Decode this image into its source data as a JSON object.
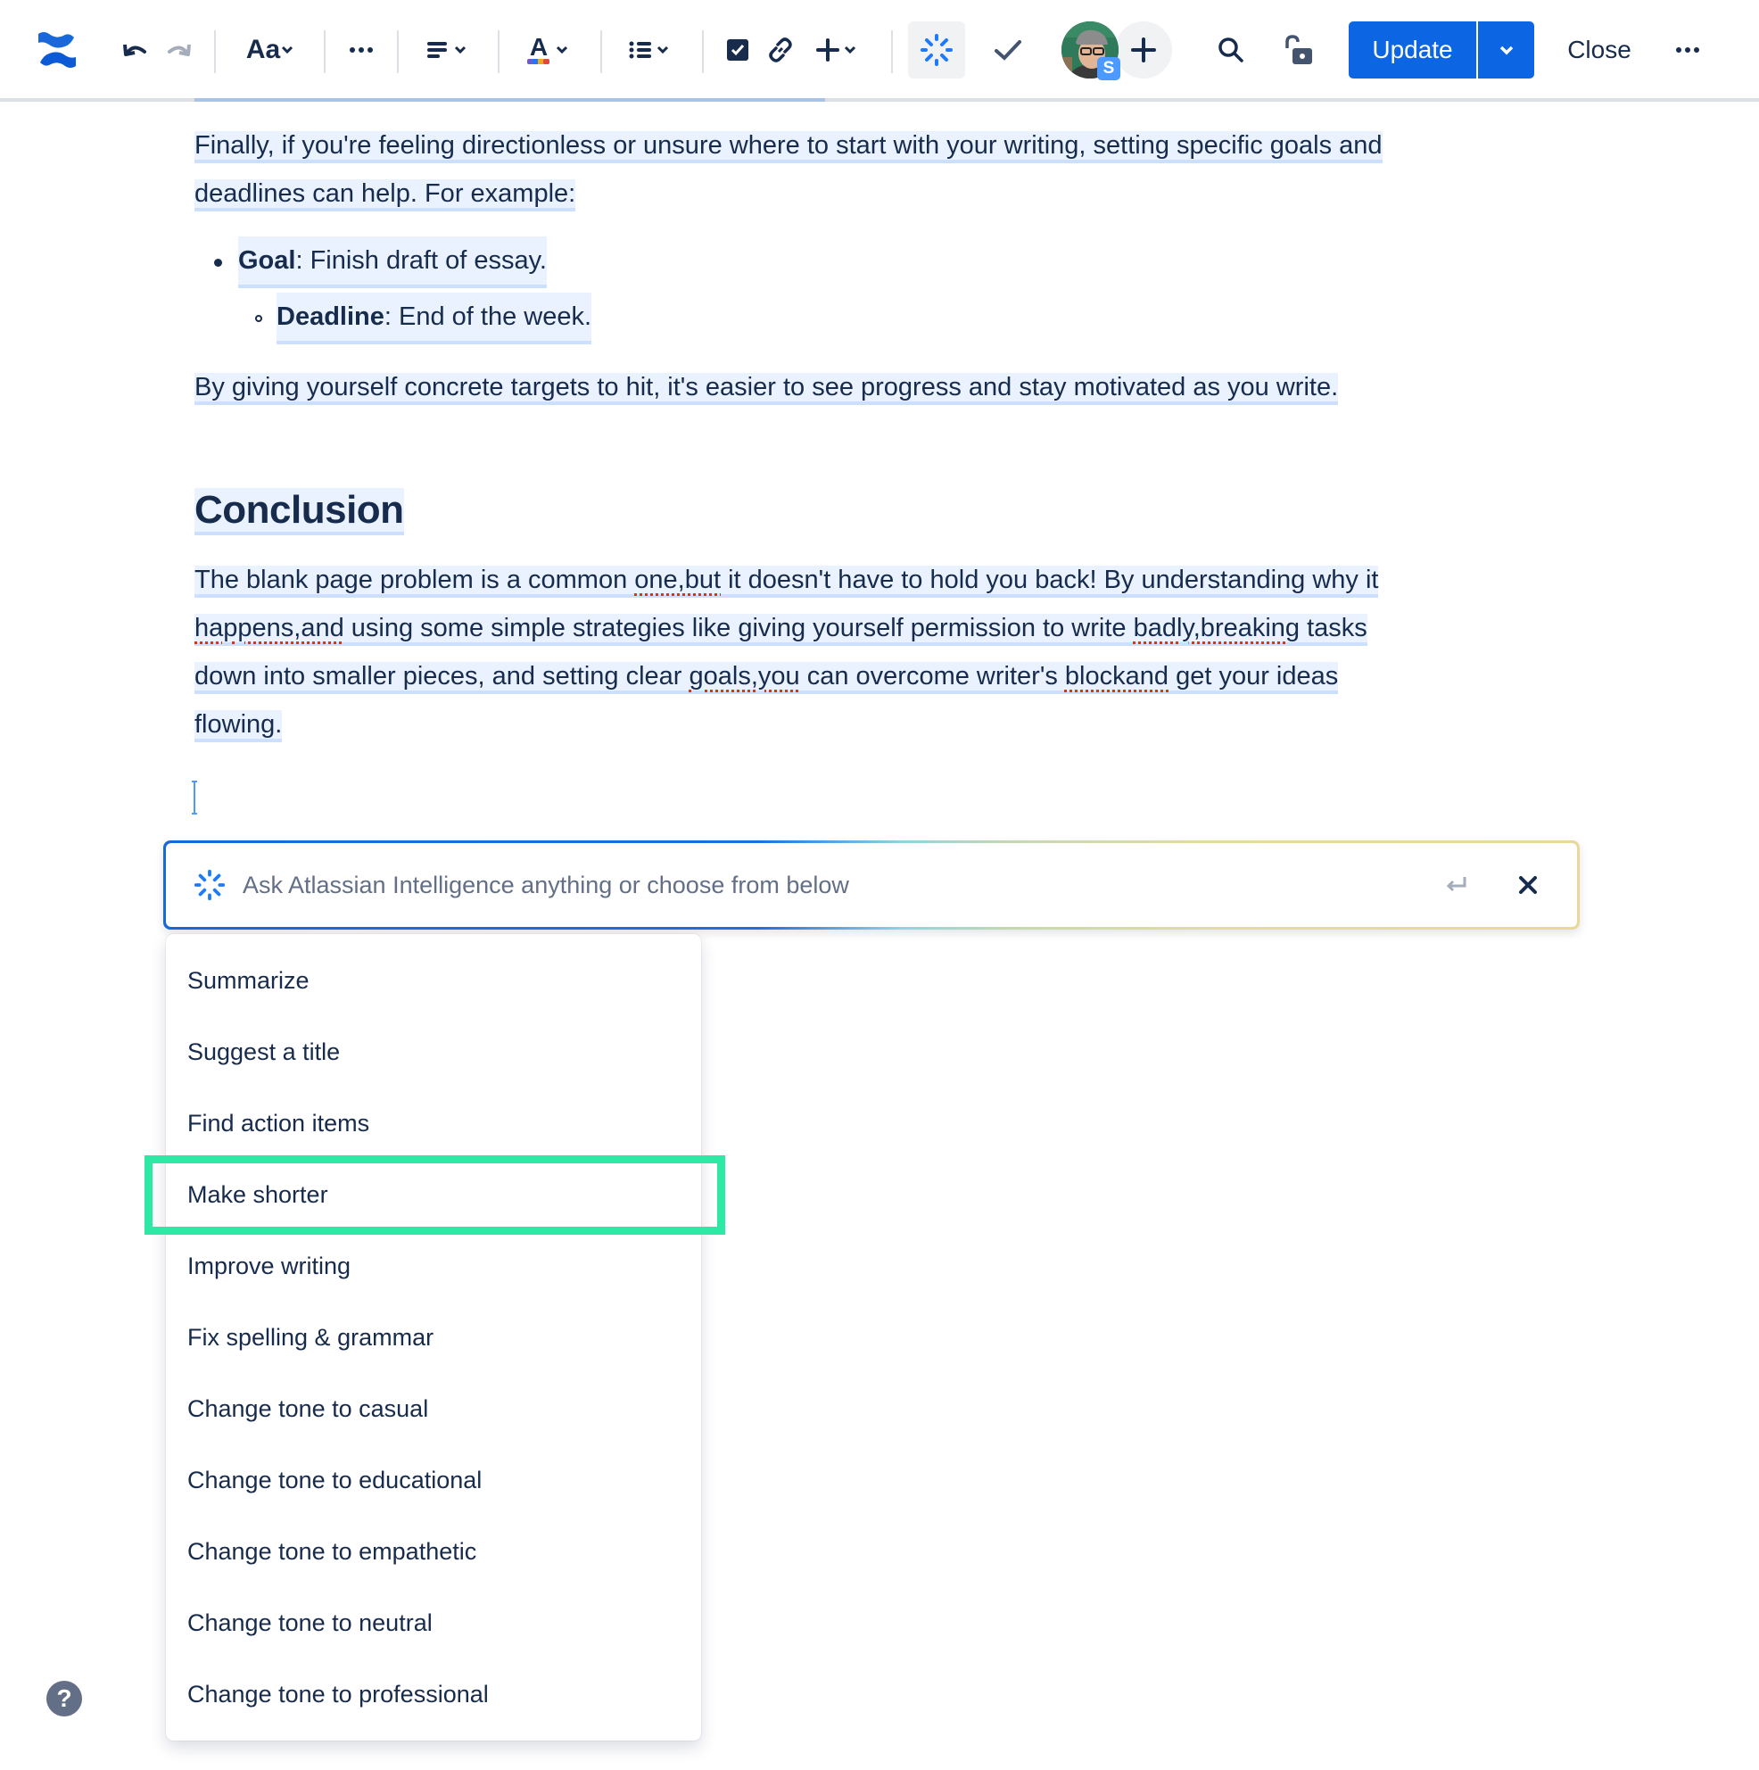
{
  "toolbar": {
    "undo": "undo-icon",
    "redo": "redo-icon",
    "text_style_label": "Aa",
    "more_formatting": "more-icon",
    "alignment": "align-icon",
    "text_color_label": "A",
    "text_color_swatches": [
      "#6e5dc6",
      "#1d7afc",
      "#f5a623",
      "#e2483d"
    ],
    "list": "bullet-list-icon",
    "action_item": "checkbox-icon",
    "link": "link-icon",
    "insert": "plus-icon",
    "ai": "atlassian-intelligence-icon",
    "check": "check-icon",
    "avatar_badge": "S",
    "add_collaborator": "plus-icon",
    "search": "search-icon",
    "restrictions": "unlock-icon",
    "update_label": "Update",
    "close_label": "Close",
    "more": "more-icon"
  },
  "document": {
    "para1_line1": "Finally, if you're feeling directionless or unsure where to start with your writing, setting specific goals and",
    "para1_line2": "deadlines can help. For example:",
    "bullet1_label": "Goal",
    "bullet1_text": ": Finish draft of essay.",
    "bullet2_label": "Deadline",
    "bullet2_text": ": End of the week.",
    "para2": "By giving yourself concrete targets to hit, it's easier to see progress and stay motivated as you write.",
    "heading": "Conclusion",
    "conclusion": {
      "l1_a": "The blank page problem is a common ",
      "l1_err": "one,but",
      "l1_b": " it doesn't have to hold you back! By understanding why it",
      "l2_err1": "happens,and",
      "l2_a": " using some simple strategies like giving yourself permission to write ",
      "l2_err2": "badly,breaking",
      "l2_b": " tasks",
      "l3_a": "down into smaller pieces, and setting clear ",
      "l3_err1": "goals,you",
      "l3_b": " can overcome writer's ",
      "l3_err2": "blockand",
      "l3_c": " get your ideas",
      "l4": "flowing."
    }
  },
  "ai_prompt": {
    "placeholder": "Ask Atlassian Intelligence anything or choose from below",
    "value": ""
  },
  "menu": {
    "items": [
      "Summarize",
      "Suggest a title",
      "Find action items",
      "Make shorter",
      "Improve writing",
      "Fix spelling & grammar",
      "Change tone to casual",
      "Change tone to educational",
      "Change tone to empathetic",
      "Change tone to neutral",
      "Change tone to professional"
    ],
    "highlighted_item": "Make shorter"
  },
  "help_label": "?",
  "colors": {
    "brand_blue": "#0c66e4",
    "text": "#172b4d",
    "highlight_annotation": "#2ee8a5"
  }
}
